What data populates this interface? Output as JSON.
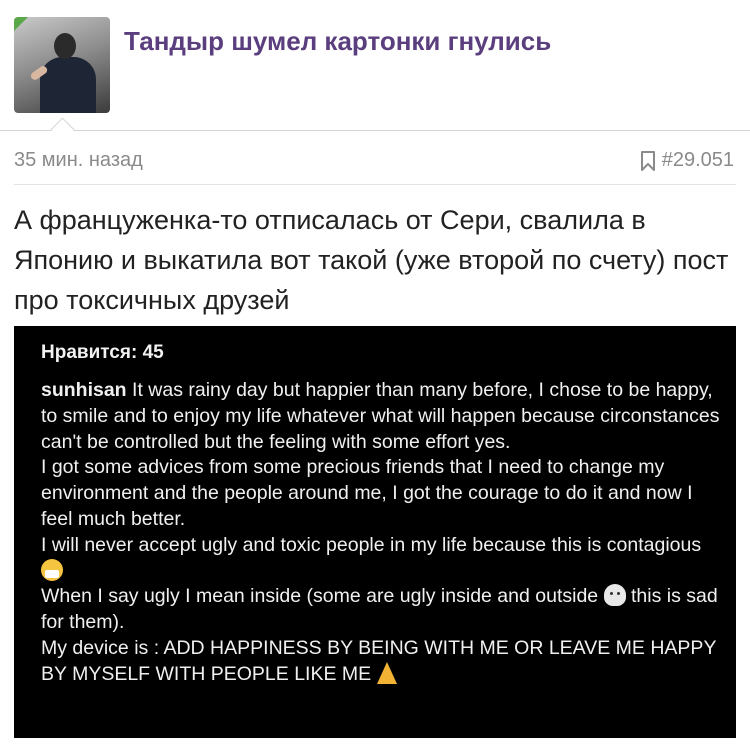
{
  "header": {
    "title": "Тандыр шумел картонки гнулись"
  },
  "meta": {
    "time": "35 мин. назад",
    "post_number": "#29.051",
    "bookmark_icon": "bookmark-icon"
  },
  "post": {
    "text": "А француженка-то отписалась от Сери, свалила в Японию и выкатила вот такой (уже второй по счету) пост про токсичных друзей"
  },
  "embedded_screenshot": {
    "likes": "Нравится: 45",
    "username": "sunhisan",
    "paragraphs": {
      "p1": "It was rainy day but happier than many before, I chose to be happy, to smile and to enjoy my life whatever what will happen because circonstances can't be controlled but the feeling with some effort yes.",
      "p2": "I got some advices from some precious friends that I need to change my environment and the people around me, I got the courage to do it and now I feel much better.",
      "p3": "I will never accept ugly and toxic people in my life because this is contagious",
      "p4": "When I say ugly I mean inside (some are ugly inside and outside",
      "p4b": "this is sad for them).",
      "p5": "My device is : ADD HAPPINESS BY BEING WITH ME OR LEAVE ME HAPPY BY MYSELF WITH PEOPLE LIKE ME"
    },
    "emojis": [
      "face-with-medical-mask-emoji",
      "ghost-emoji",
      "folded-hands-emoji"
    ]
  },
  "colors": {
    "title": "#5b3e7e",
    "meta": "#8a8a8a",
    "screenshot_bg": "#000000"
  }
}
